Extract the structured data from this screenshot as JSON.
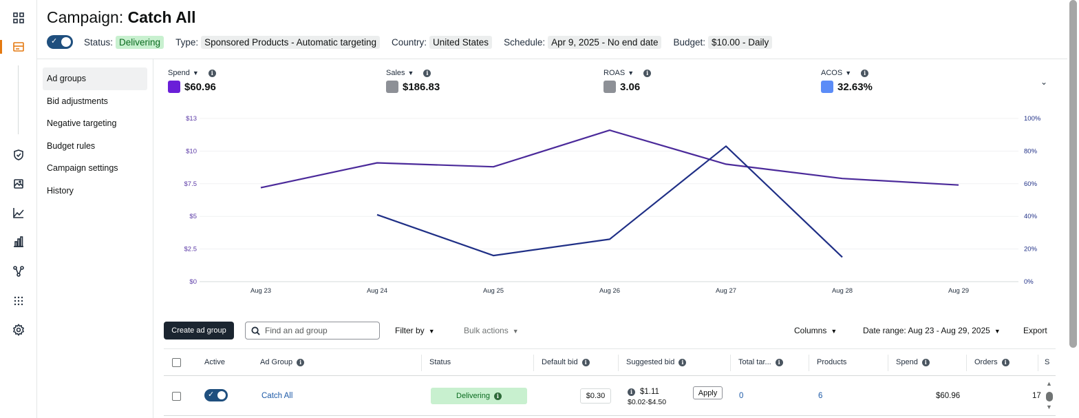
{
  "rail": {
    "icons": [
      "dashboard-icon",
      "campaigns-icon",
      "shield-icon",
      "image-icon",
      "trend-icon",
      "bar-chart-icon",
      "network-icon",
      "apps-grid-icon",
      "settings-icon"
    ],
    "accent_color": "#e47911"
  },
  "header": {
    "title_prefix": "Campaign:",
    "title_name": "Catch All",
    "status_label": "Status:",
    "status_value": "Delivering",
    "type_label": "Type:",
    "type_value": "Sponsored Products - Automatic targeting",
    "country_label": "Country:",
    "country_value": "United States",
    "schedule_label": "Schedule:",
    "schedule_value": "Apr 9, 2025 - No end date",
    "budget_label": "Budget:",
    "budget_value": "$10.00 - Daily",
    "campaign_enabled": true
  },
  "sidenav": {
    "items": [
      {
        "label": "Ad groups",
        "active": true
      },
      {
        "label": "Bid adjustments",
        "active": false
      },
      {
        "label": "Negative targeting",
        "active": false
      },
      {
        "label": "Budget rules",
        "active": false
      },
      {
        "label": "Campaign settings",
        "active": false
      },
      {
        "label": "History",
        "active": false
      }
    ]
  },
  "metrics": [
    {
      "label": "Spend",
      "value": "$60.96",
      "color": "#6a1fd8"
    },
    {
      "label": "Sales",
      "value": "$186.83",
      "color": "#8d9096"
    },
    {
      "label": "ROAS",
      "value": "3.06",
      "color": "#8d9096"
    },
    {
      "label": "ACOS",
      "value": "32.63%",
      "color": "#5b8cf7"
    }
  ],
  "chart_data": {
    "type": "line",
    "categories": [
      "Aug 23",
      "Aug 24",
      "Aug 25",
      "Aug 26",
      "Aug 27",
      "Aug 28",
      "Aug 29"
    ],
    "y_left_ticks": [
      "$0",
      "$2.5",
      "$5",
      "$7.5",
      "$10",
      "$13"
    ],
    "y_right_ticks": [
      "0%",
      "20%",
      "40%",
      "60%",
      "80%",
      "100%"
    ],
    "y_left_lim": [
      0,
      12.5
    ],
    "y_right_lim": [
      0,
      100
    ],
    "series": [
      {
        "name": "Spend",
        "axis": "left",
        "color": "#4b2a9a",
        "values": [
          7.2,
          9.1,
          8.8,
          11.6,
          9.0,
          7.9,
          7.4
        ]
      },
      {
        "name": "ACOS",
        "axis": "right",
        "color": "#1f2f86",
        "values": [
          null,
          41,
          16,
          26,
          83,
          15,
          null
        ]
      }
    ],
    "left_axis_color": "#5b3aa6",
    "right_axis_color": "#1f2f86",
    "grid": true
  },
  "toolbar": {
    "create_label": "Create ad group",
    "search_placeholder": "Find an ad group",
    "filter_label": "Filter by",
    "bulk_label": "Bulk actions",
    "columns_label": "Columns",
    "date_range_label": "Date range: Aug 23 - Aug 29, 2025",
    "export_label": "Export"
  },
  "table": {
    "headers": {
      "active": "Active",
      "ad_group": "Ad Group",
      "status": "Status",
      "default_bid": "Default bid",
      "suggested_bid": "Suggested bid",
      "total_targets": "Total tar...",
      "products": "Products",
      "spend": "Spend",
      "orders": "Orders",
      "overflow": "S"
    },
    "rows": [
      {
        "active": true,
        "ad_group": "Catch All",
        "status": "Delivering",
        "default_bid": "$0.30",
        "suggested_bid": "$1.11",
        "suggested_range": "$0.02-$4.50",
        "apply_label": "Apply",
        "total_targets": "0",
        "products": "6",
        "spend": "$60.96",
        "orders": "17"
      }
    ]
  }
}
